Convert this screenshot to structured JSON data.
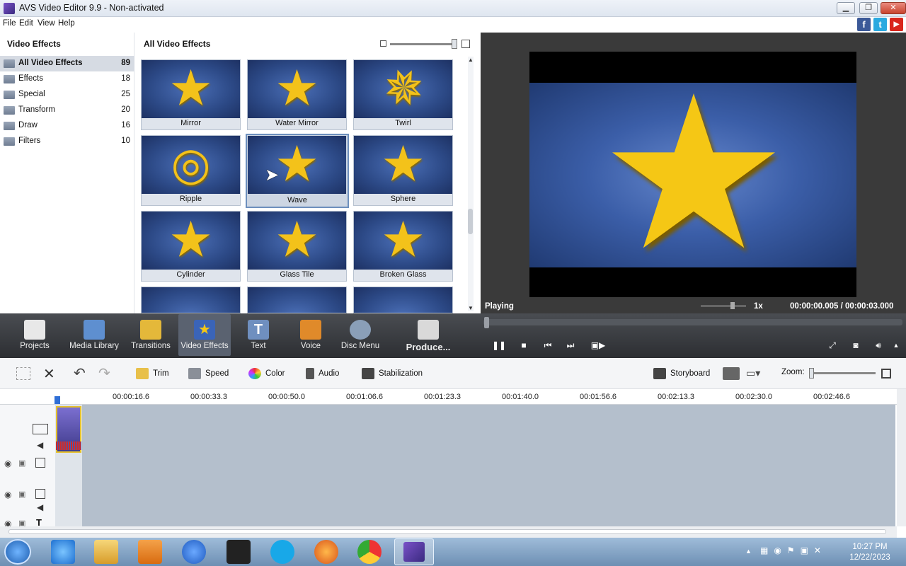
{
  "window": {
    "title": "AVS Video Editor 9.9 - Non-activated",
    "controls": [
      "minimize",
      "restore",
      "close"
    ]
  },
  "menu": {
    "items": [
      "File",
      "Edit",
      "View",
      "Help"
    ],
    "social": [
      "f",
      "t",
      "▶"
    ]
  },
  "left_panel": {
    "title": "Video Effects",
    "categories": [
      {
        "label": "All Video Effects",
        "count": "89",
        "selected": true
      },
      {
        "label": "Effects",
        "count": "18"
      },
      {
        "label": "Special",
        "count": "25"
      },
      {
        "label": "Transform",
        "count": "20"
      },
      {
        "label": "Draw",
        "count": "16"
      },
      {
        "label": "Filters",
        "count": "10"
      }
    ]
  },
  "grid": {
    "title": "All Video Effects",
    "thumbnails": [
      {
        "label": "Mirror"
      },
      {
        "label": "Water Mirror"
      },
      {
        "label": "Twirl"
      },
      {
        "label": "Ripple"
      },
      {
        "label": "Wave",
        "selected": true
      },
      {
        "label": "Sphere"
      },
      {
        "label": "Cylinder"
      },
      {
        "label": "Glass Tile"
      },
      {
        "label": "Broken Glass"
      }
    ]
  },
  "preview": {
    "status": "Playing",
    "speed": "1x",
    "timecode_current": "00:00:00.005",
    "timecode_separator": "/",
    "timecode_total": "00:00:03.000"
  },
  "main_toolbar": {
    "items": [
      {
        "label": "Projects",
        "icon": "clapper-icon",
        "color": "#e8e8e8"
      },
      {
        "label": "Media Library",
        "icon": "film-icon",
        "color": "#5e8fd0"
      },
      {
        "label": "Transitions",
        "icon": "transition-icon",
        "color": "#e4b83a"
      },
      {
        "label": "Video Effects",
        "icon": "star-icon",
        "color": "#3a64b8",
        "selected": true
      },
      {
        "label": "Text",
        "icon": "text-icon",
        "color": "#6f8fbf"
      },
      {
        "label": "Voice",
        "icon": "microphone-icon",
        "color": "#e08a2a"
      },
      {
        "label": "Disc Menu",
        "icon": "disc-icon",
        "color": "#8a9fb8"
      },
      {
        "label": "Produce...",
        "icon": "produce-icon",
        "color": "#d9d9d9"
      }
    ]
  },
  "edit_toolbar": {
    "trim": "Trim",
    "speed": "Speed",
    "color": "Color",
    "audio": "Audio",
    "stabilization": "Stabilization",
    "storyboard": "Storyboard",
    "zoom": "Zoom:"
  },
  "timeline": {
    "ticks": [
      "00:00:16.6",
      "00:00:33.3",
      "00:00:50.0",
      "00:01:06.6",
      "00:01:23.3",
      "00:01:40.0",
      "00:01:56.6",
      "00:02:13.3",
      "00:02:30.0",
      "00:02:46.6"
    ]
  },
  "taskbar": {
    "time": "10:27 PM",
    "date": "12/22/2023"
  }
}
